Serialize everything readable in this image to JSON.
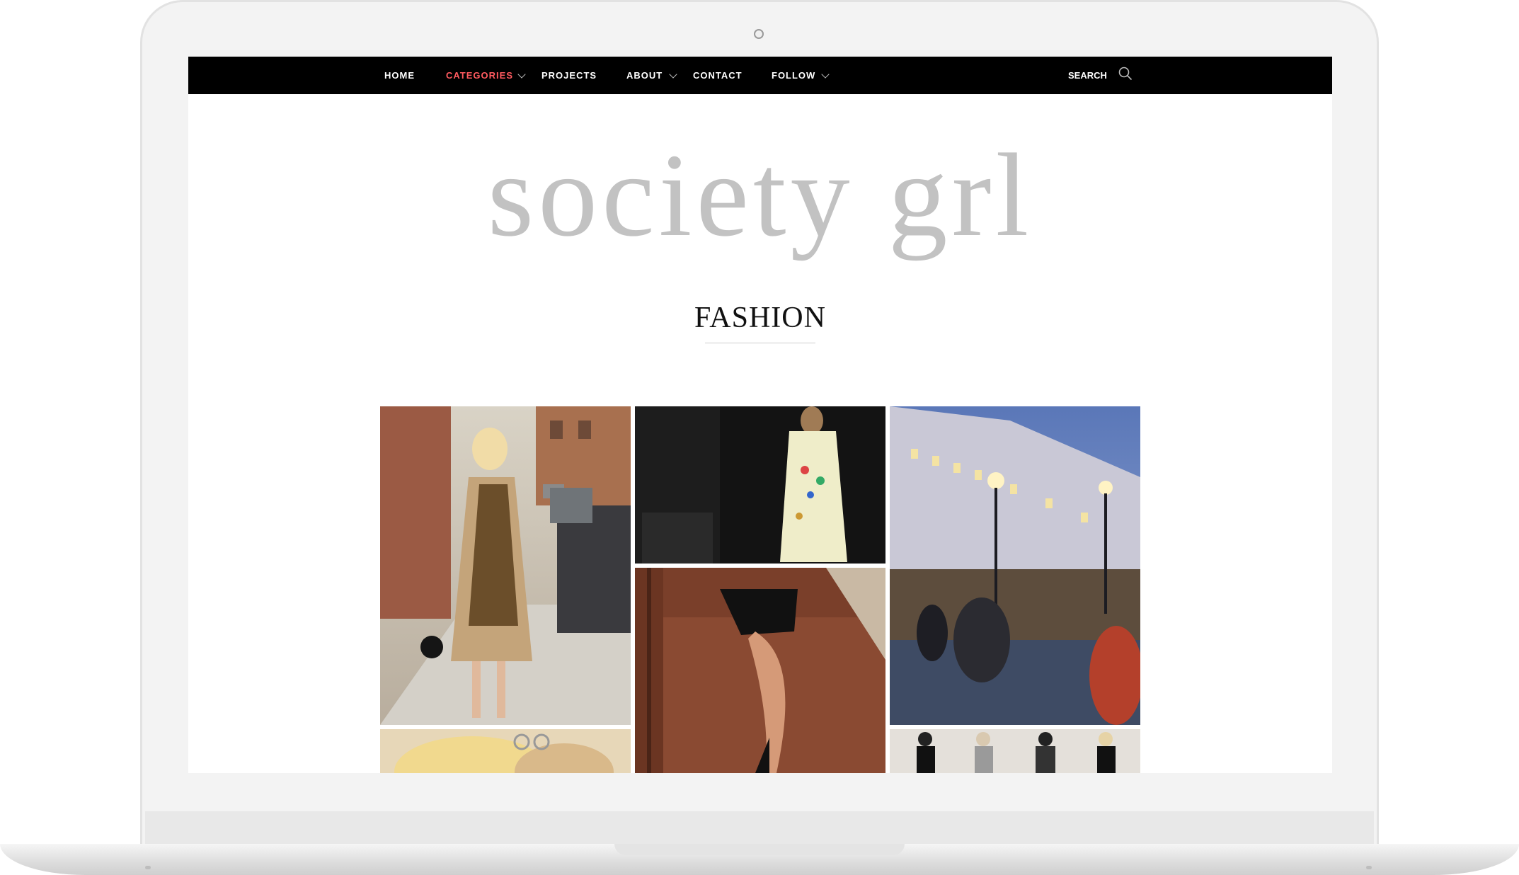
{
  "nav": {
    "items": [
      {
        "label": "HOME",
        "active": false,
        "has_dropdown": false
      },
      {
        "label": "CATEGORIES",
        "active": true,
        "has_dropdown": true
      },
      {
        "label": "PROJECTS",
        "active": false,
        "has_dropdown": false
      },
      {
        "label": "ABOUT",
        "active": false,
        "has_dropdown": true
      },
      {
        "label": "CONTACT",
        "active": false,
        "has_dropdown": false
      },
      {
        "label": "FOLLOW",
        "active": false,
        "has_dropdown": true
      }
    ],
    "search_label": "SEARCH",
    "search_icon": "search-icon"
  },
  "site": {
    "logo_text": "society grl"
  },
  "page": {
    "title": "FASHION"
  },
  "gallery": {
    "images": [
      {
        "name": "street-style-leopard-dress-photo"
      },
      {
        "name": "embroidered-coat-back-photo"
      },
      {
        "name": "regent-street-night-photo"
      },
      {
        "name": "legs-heels-stairs-photo"
      },
      {
        "name": "sunglasses-blonde-photo"
      },
      {
        "name": "runway-models-photo"
      }
    ]
  },
  "colors": {
    "nav_bg": "#000000",
    "accent": "#ff5a5f",
    "logo": "#c2c2c2"
  }
}
